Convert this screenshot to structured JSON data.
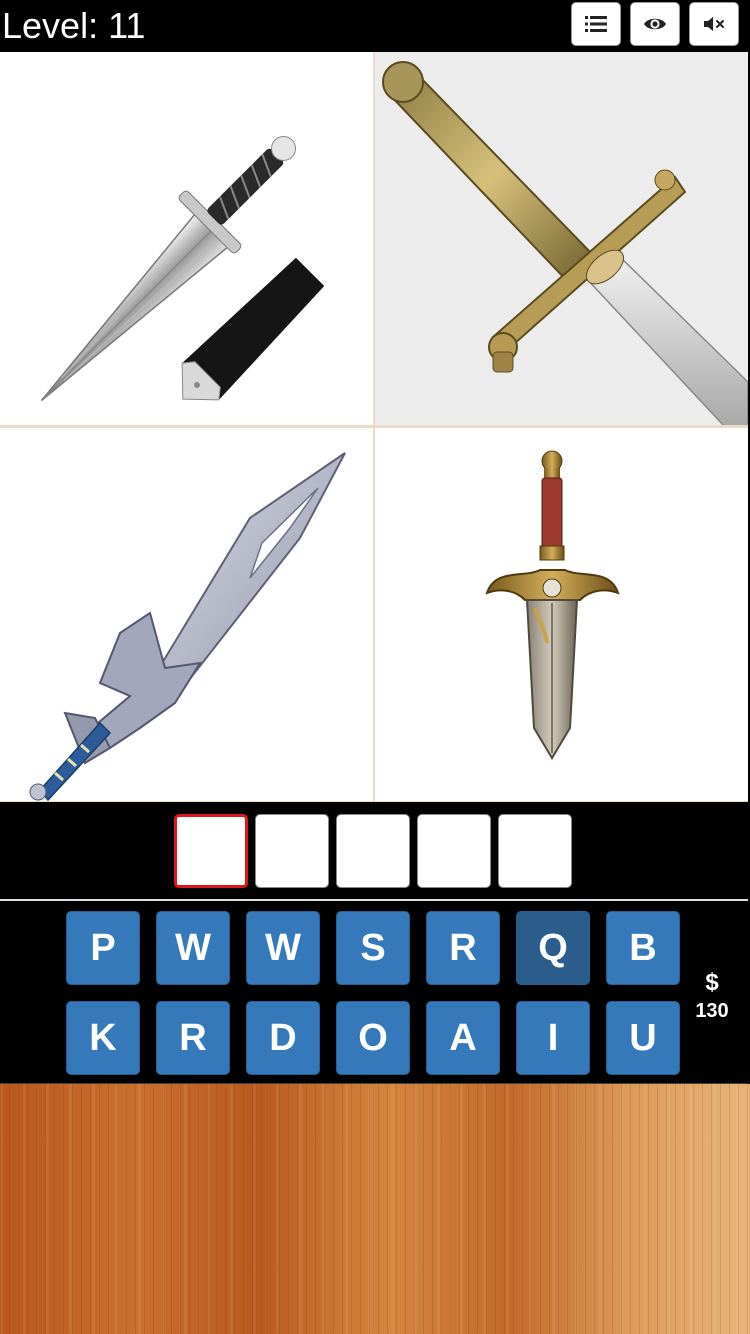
{
  "header": {
    "level_label": "Level: 11",
    "buttons": [
      {
        "icon": "list-icon"
      },
      {
        "icon": "eye-icon"
      },
      {
        "icon": "mute-icon"
      }
    ]
  },
  "pictures": [
    {
      "subject": "dagger-with-sheath"
    },
    {
      "subject": "golden-hilt-sword"
    },
    {
      "subject": "fantasy-sword"
    },
    {
      "subject": "ornate-dagger"
    }
  ],
  "answer": {
    "slots": [
      "",
      "",
      "",
      "",
      ""
    ],
    "active_slot": 0
  },
  "keyboard": {
    "row1": [
      "P",
      "W",
      "W",
      "S",
      "R",
      "Q",
      "B"
    ],
    "row2": [
      "K",
      "R",
      "D",
      "O",
      "A",
      "I",
      "U"
    ]
  },
  "coins": {
    "symbol": "$",
    "amount": "130"
  },
  "colors": {
    "key": "#3579ba",
    "key_used": "#2b5d8c",
    "active_slot_border": "#e0161d",
    "header_bg": "#000000"
  }
}
